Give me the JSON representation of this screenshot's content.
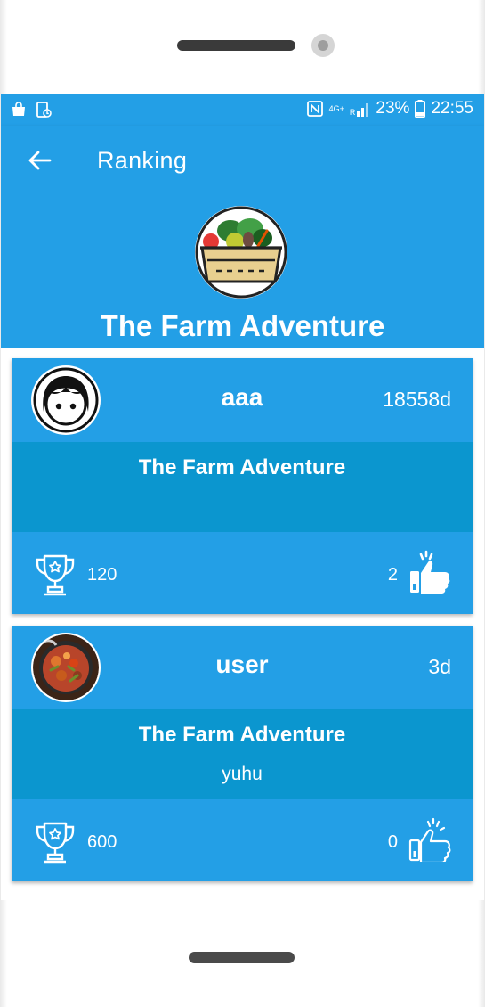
{
  "status_bar": {
    "network": "4G+",
    "roaming": "R",
    "battery": "23%",
    "time": "22:55"
  },
  "app_bar": {
    "title": "Ranking"
  },
  "header": {
    "game_title": "The Farm Adventure"
  },
  "rankings": [
    {
      "username": "aaa",
      "time_ago": "18558d",
      "game": "The Farm Adventure",
      "comment": "",
      "score": "120",
      "likes": "2",
      "liked": true
    },
    {
      "username": "user",
      "time_ago": "3d",
      "game": "The Farm Adventure",
      "comment": "yuhu",
      "score": "600",
      "likes": "0",
      "liked": false
    }
  ],
  "colors": {
    "primary": "#239fe6",
    "card_mid": "#0b96cf",
    "text": "#ffffff"
  }
}
